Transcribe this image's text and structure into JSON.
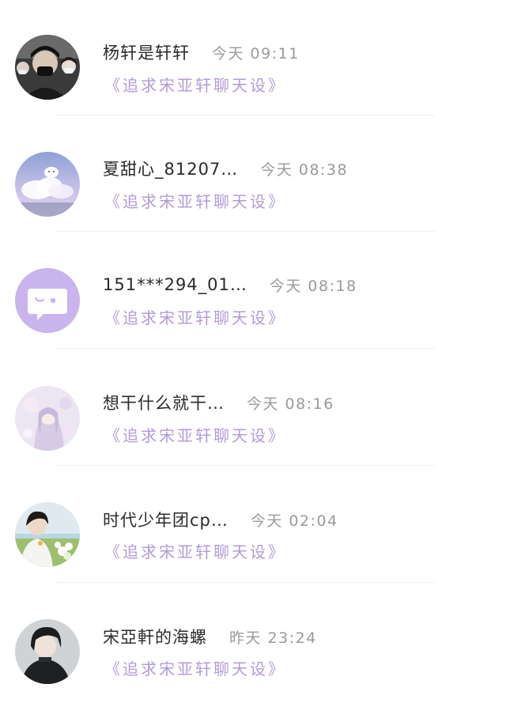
{
  "chats": [
    {
      "name": "杨轩是轩轩",
      "time": "今天 09:11",
      "preview": "《追求宋亚轩聊天设》",
      "avatar_icon": "couple-photo-avatar"
    },
    {
      "name": "夏甜心_81207…",
      "time": "今天 08:38",
      "preview": "《追求宋亚轩聊天设》",
      "avatar_icon": "cloud-sky-avatar"
    },
    {
      "name": "151***294_01…",
      "time": "今天 08:18",
      "preview": "《追求宋亚轩聊天设》",
      "avatar_icon": "default-chat-bubble-avatar"
    },
    {
      "name": "想干什么就干…",
      "time": "今天 08:16",
      "preview": "《追求宋亚轩聊天设》",
      "avatar_icon": "anime-girl-avatar"
    },
    {
      "name": "时代少年团cp…",
      "time": "今天 02:04",
      "preview": "《追求宋亚轩聊天设》",
      "avatar_icon": "boy-with-flowers-avatar"
    },
    {
      "name": "宋亞軒的海螺",
      "time": "昨天 23:24",
      "preview": "《追求宋亚轩聊天设》",
      "avatar_icon": "boy-portrait-avatar"
    }
  ],
  "colors": {
    "name": "#2a2a2a",
    "time": "#9a9a9a",
    "preview": "#b39ad8",
    "default_avatar_bg": "#c9b4ee"
  }
}
